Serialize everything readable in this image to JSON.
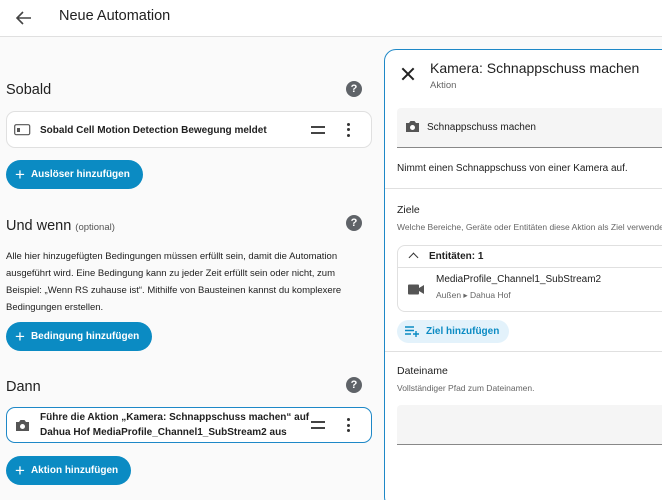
{
  "header": {
    "title": "Neue Automation",
    "back_icon": "arrow-left-icon"
  },
  "sobald": {
    "title": "Sobald",
    "trigger": {
      "label": "Sobald Cell Motion Detection Bewegung meldet",
      "icon": "motion-sensor-icon"
    },
    "add_label": "Auslöser hinzufügen"
  },
  "und_wenn": {
    "title": "Und wenn",
    "optional": "(optional)",
    "description": "Alle hier hinzugefügten Bedingungen müssen erfüllt sein, damit die Automation ausgeführt wird. Eine Bedingung kann zu jeder Zeit erfüllt sein oder nicht, zum Beispiel: „Wenn RS zuhause ist“. Mithilfe von Bausteinen kannst du komplexere Bedingungen erstellen.",
    "add_label": "Bedingung hinzufügen"
  },
  "dann": {
    "title": "Dann",
    "action": {
      "line1": "Führe die Aktion „Kamera: Schnappschuss machen“ auf",
      "line2": "Dahua Hof MediaProfile_Channel1_SubStream2 aus",
      "icon": "camera-icon"
    },
    "add_label": "Aktion hinzufügen"
  },
  "panel": {
    "title": "Kamera: Schnappschuss machen",
    "subtitle": "Aktion",
    "action_select": "Schnappschuss machen",
    "description": "Nimmt einen Schnappschuss von einer Kamera auf.",
    "targets_label": "Ziele",
    "targets_hint": "Welche Bereiche, Geräte oder Entitäten diese Aktion als Ziel verwenden soll",
    "entities_header": "Entitäten: 1",
    "entity_name": "MediaProfile_Channel1_SubStream2",
    "entity_path": "Außen ▸ Dahua Hof",
    "add_target": "Ziel hinzufügen",
    "filename_label": "Dateiname",
    "filename_hint": "Vollständiger Pfad zum Dateinamen.",
    "filename_value": ""
  },
  "colors": {
    "accent": "#0b8bc3",
    "active_border": "#1e88c7"
  }
}
